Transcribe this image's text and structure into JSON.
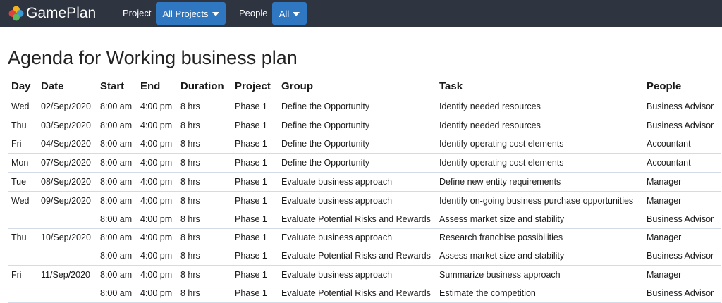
{
  "app": {
    "name": "GamePlan",
    "logo_icon": "colored-dots-logo-icon",
    "logo_colors": [
      "#f2b21a",
      "#e0413b",
      "#3a9ad9",
      "#5cb85c"
    ]
  },
  "nav": {
    "project_label": "Project",
    "project_value": "All Projects",
    "people_label": "People",
    "people_value": "All",
    "accent": "#2f77c0",
    "bar_color": "#2e3440"
  },
  "page": {
    "title": "Agenda for Working business plan"
  },
  "table": {
    "headers": [
      "Day",
      "Date",
      "Start",
      "End",
      "Duration",
      "Project",
      "Group",
      "Task",
      "People"
    ],
    "rows": [
      {
        "day": "Wed",
        "date": "02/Sep/2020",
        "start": "8:00 am",
        "end": "4:00 pm",
        "duration": "8 hrs",
        "project": "Phase 1",
        "group": "Define the Opportunity",
        "task": "Identify needed resources",
        "people": "Business Advisor",
        "new_day": true
      },
      {
        "day": "Thu",
        "date": "03/Sep/2020",
        "start": "8:00 am",
        "end": "4:00 pm",
        "duration": "8 hrs",
        "project": "Phase 1",
        "group": "Define the Opportunity",
        "task": "Identify needed resources",
        "people": "Business Advisor",
        "new_day": true
      },
      {
        "day": "Fri",
        "date": "04/Sep/2020",
        "start": "8:00 am",
        "end": "4:00 pm",
        "duration": "8 hrs",
        "project": "Phase 1",
        "group": "Define the Opportunity",
        "task": "Identify operating cost elements",
        "people": "Accountant",
        "new_day": true
      },
      {
        "day": "Mon",
        "date": "07/Sep/2020",
        "start": "8:00 am",
        "end": "4:00 pm",
        "duration": "8 hrs",
        "project": "Phase 1",
        "group": "Define the Opportunity",
        "task": "Identify operating cost elements",
        "people": "Accountant",
        "new_day": true
      },
      {
        "day": "Tue",
        "date": "08/Sep/2020",
        "start": "8:00 am",
        "end": "4:00 pm",
        "duration": "8 hrs",
        "project": "Phase 1",
        "group": "Evaluate business approach",
        "task": "Define new entity requirements",
        "people": "Manager",
        "new_day": true
      },
      {
        "day": "Wed",
        "date": "09/Sep/2020",
        "start": "8:00 am",
        "end": "4:00 pm",
        "duration": "8 hrs",
        "project": "Phase 1",
        "group": "Evaluate business approach",
        "task": "Identify on-going business purchase opportunities",
        "people": "Manager",
        "new_day": true
      },
      {
        "day": "",
        "date": "",
        "start": "8:00 am",
        "end": "4:00 pm",
        "duration": "8 hrs",
        "project": "Phase 1",
        "group": "Evaluate Potential Risks and Rewards",
        "task": "Assess market size and stability",
        "people": "Business Advisor",
        "new_day": false
      },
      {
        "day": "Thu",
        "date": "10/Sep/2020",
        "start": "8:00 am",
        "end": "4:00 pm",
        "duration": "8 hrs",
        "project": "Phase 1",
        "group": "Evaluate business approach",
        "task": "Research franchise possibilities",
        "people": "Manager",
        "new_day": true
      },
      {
        "day": "",
        "date": "",
        "start": "8:00 am",
        "end": "4:00 pm",
        "duration": "8 hrs",
        "project": "Phase 1",
        "group": "Evaluate Potential Risks and Rewards",
        "task": "Assess market size and stability",
        "people": "Business Advisor",
        "new_day": false
      },
      {
        "day": "Fri",
        "date": "11/Sep/2020",
        "start": "8:00 am",
        "end": "4:00 pm",
        "duration": "8 hrs",
        "project": "Phase 1",
        "group": "Evaluate business approach",
        "task": "Summarize business approach",
        "people": "Manager",
        "new_day": true
      },
      {
        "day": "",
        "date": "",
        "start": "8:00 am",
        "end": "4:00 pm",
        "duration": "8 hrs",
        "project": "Phase 1",
        "group": "Evaluate Potential Risks and Rewards",
        "task": "Estimate the competition",
        "people": "Business Advisor",
        "new_day": false
      }
    ]
  }
}
